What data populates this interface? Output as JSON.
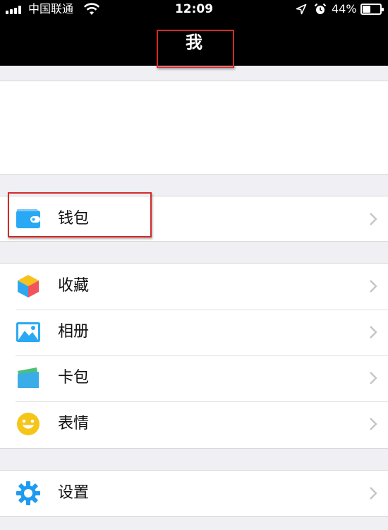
{
  "status_bar": {
    "carrier": "中国联通",
    "time": "12:09",
    "battery_percent": "44%",
    "battery_level": 0.44,
    "icons": [
      "signal-icon",
      "wifi-icon",
      "location-icon",
      "alarm-icon",
      "battery-icon"
    ]
  },
  "nav": {
    "title": "我"
  },
  "menu": {
    "wallet": {
      "label": "钱包",
      "icon": "wallet-icon",
      "color": "#29a9f5"
    },
    "favorites": {
      "label": "收藏",
      "icon": "cube-icon"
    },
    "album": {
      "label": "相册",
      "icon": "photo-icon",
      "color": "#29a9f5"
    },
    "cards": {
      "label": "卡包",
      "icon": "card-holder-icon",
      "color": "#3aace8"
    },
    "stickers": {
      "label": "表情",
      "icon": "smiley-icon",
      "color": "#f5c518"
    },
    "settings": {
      "label": "设置",
      "icon": "gear-icon",
      "color": "#1d9bf0"
    }
  },
  "annotation_color": "#d42a2a"
}
